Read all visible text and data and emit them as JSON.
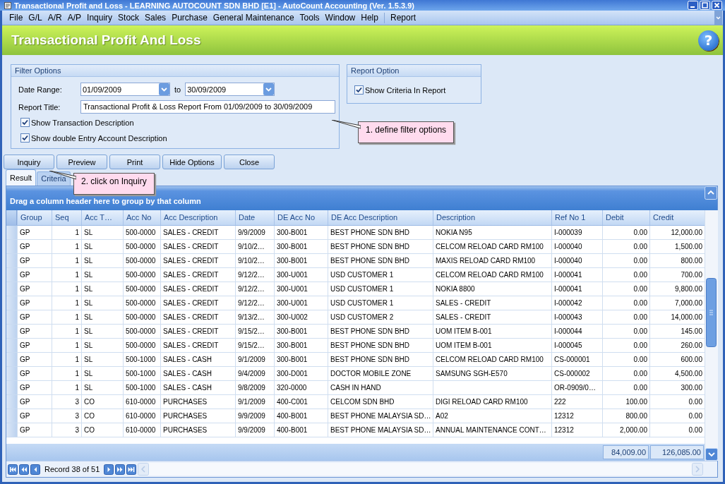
{
  "window": {
    "title": "Transactional Profit and Loss - LEARNING AUTOCOUNT SDN BHD [E1] - AutoCount Accounting (Ver. 1.5.3.9)"
  },
  "menu": {
    "items": [
      "File",
      "G/L",
      "A/R",
      "A/P",
      "Inquiry",
      "Stock",
      "Sales",
      "Purchase",
      "General Maintenance",
      "Tools",
      "Window",
      "Help"
    ],
    "extra": [
      "Report"
    ]
  },
  "header": {
    "title": "Transactional Profit And Loss",
    "help": "?"
  },
  "filter_options": {
    "title": "Filter Options",
    "date_range": {
      "label": "Date Range:",
      "from": "01/09/2009",
      "separator": "to",
      "to": "30/09/2009"
    },
    "report_title": {
      "label": "Report Title:",
      "value": "Transactional Profit & Loss Report From 01/09/2009 to 30/09/2009"
    },
    "checkboxes": [
      {
        "label": "Show Transaction Description",
        "checked": true
      },
      {
        "label": "Show double Entry Account Description",
        "checked": true
      }
    ]
  },
  "report_option": {
    "title": "Report Option",
    "checkboxes": [
      {
        "label": "Show Criteria In Report",
        "checked": true
      }
    ]
  },
  "buttons": [
    "Inquiry",
    "Preview",
    "Print",
    "Hide Options",
    "Close"
  ],
  "callouts": [
    {
      "text": "1. define filter options"
    },
    {
      "text": "2. click on Inquiry"
    }
  ],
  "tabs": [
    {
      "label": "Result",
      "selected": true
    },
    {
      "label": "Criteria",
      "selected": false
    }
  ],
  "grid": {
    "group_panel": "Drag a column header here to group by that column",
    "columns": [
      {
        "label": "Group",
        "kind": "text"
      },
      {
        "label": "Seq",
        "kind": "number"
      },
      {
        "label": "Acc T…",
        "kind": "text"
      },
      {
        "label": "Acc No",
        "kind": "text"
      },
      {
        "label": "Acc Description",
        "kind": "text"
      },
      {
        "label": "Date",
        "kind": "text"
      },
      {
        "label": "DE Acc No",
        "kind": "text"
      },
      {
        "label": "DE Acc Description",
        "kind": "text"
      },
      {
        "label": "Description",
        "kind": "text"
      },
      {
        "label": "Ref No 1",
        "kind": "text"
      },
      {
        "label": "Debit",
        "kind": "number"
      },
      {
        "label": "Credit",
        "kind": "number"
      }
    ],
    "rows": [
      [
        "GP",
        "1",
        "SL",
        "500-0000",
        "SALES - CREDIT",
        "9/9/2009",
        "300-B001",
        "BEST PHONE SDN BHD",
        "NOKIA N95",
        "I-000039",
        "0.00",
        "12,000.00"
      ],
      [
        "GP",
        "1",
        "SL",
        "500-0000",
        "SALES - CREDIT",
        "9/10/2…",
        "300-B001",
        "BEST PHONE SDN BHD",
        "CELCOM RELOAD CARD RM100",
        "I-000040",
        "0.00",
        "1,500.00"
      ],
      [
        "GP",
        "1",
        "SL",
        "500-0000",
        "SALES - CREDIT",
        "9/10/2…",
        "300-B001",
        "BEST PHONE SDN BHD",
        "MAXIS RELOAD CARD RM100",
        "I-000040",
        "0.00",
        "800.00"
      ],
      [
        "GP",
        "1",
        "SL",
        "500-0000",
        "SALES - CREDIT",
        "9/12/2…",
        "300-U001",
        "USD CUSTOMER 1",
        "CELCOM RELOAD CARD RM100",
        "I-000041",
        "0.00",
        "700.00"
      ],
      [
        "GP",
        "1",
        "SL",
        "500-0000",
        "SALES - CREDIT",
        "9/12/2…",
        "300-U001",
        "USD CUSTOMER 1",
        "NOKIA 8800",
        "I-000041",
        "0.00",
        "9,800.00"
      ],
      [
        "GP",
        "1",
        "SL",
        "500-0000",
        "SALES - CREDIT",
        "9/12/2…",
        "300-U001",
        "USD CUSTOMER 1",
        "SALES - CREDIT",
        "I-000042",
        "0.00",
        "7,000.00"
      ],
      [
        "GP",
        "1",
        "SL",
        "500-0000",
        "SALES - CREDIT",
        "9/13/2…",
        "300-U002",
        "USD CUSTOMER 2",
        "SALES - CREDIT",
        "I-000043",
        "0.00",
        "14,000.00"
      ],
      [
        "GP",
        "1",
        "SL",
        "500-0000",
        "SALES - CREDIT",
        "9/15/2…",
        "300-B001",
        "BEST PHONE SDN BHD",
        "UOM ITEM B-001",
        "I-000044",
        "0.00",
        "145.00"
      ],
      [
        "GP",
        "1",
        "SL",
        "500-0000",
        "SALES - CREDIT",
        "9/15/2…",
        "300-B001",
        "BEST PHONE SDN BHD",
        "UOM ITEM B-001",
        "I-000045",
        "0.00",
        "260.00"
      ],
      [
        "GP",
        "1",
        "SL",
        "500-1000",
        "SALES - CASH",
        "9/1/2009",
        "300-B001",
        "BEST PHONE SDN BHD",
        "CELCOM RELOAD CARD RM100",
        "CS-000001",
        "0.00",
        "600.00"
      ],
      [
        "GP",
        "1",
        "SL",
        "500-1000",
        "SALES - CASH",
        "9/4/2009",
        "300-D001",
        "DOCTOR MOBILE ZONE",
        "SAMSUNG SGH-E570",
        "CS-000002",
        "0.00",
        "4,500.00"
      ],
      [
        "GP",
        "1",
        "SL",
        "500-1000",
        "SALES - CASH",
        "9/8/2009",
        "320-0000",
        "CASH IN HAND",
        "",
        "OR-0909/0…",
        "0.00",
        "300.00"
      ],
      [
        "GP",
        "3",
        "CO",
        "610-0000",
        "PURCHASES",
        "9/1/2009",
        "400-C001",
        "CELCOM SDN BHD",
        "DIGI RELOAD CARD RM100",
        "222",
        "100.00",
        "0.00"
      ],
      [
        "GP",
        "3",
        "CO",
        "610-0000",
        "PURCHASES",
        "9/9/2009",
        "400-B001",
        "BEST PHONE MALAYSIA SD…",
        "A02",
        "12312",
        "800.00",
        "0.00"
      ],
      [
        "GP",
        "3",
        "CO",
        "610-0000",
        "PURCHASES",
        "9/9/2009",
        "400-B001",
        "BEST PHONE MALAYSIA SD…",
        "ANNUAL MAINTENANCE CONT…",
        "12312",
        "2,000.00",
        "0.00"
      ]
    ],
    "totals": [
      "84,009.00",
      "126,085.00"
    ]
  },
  "navigator": {
    "record": "Record 38 of 51"
  }
}
